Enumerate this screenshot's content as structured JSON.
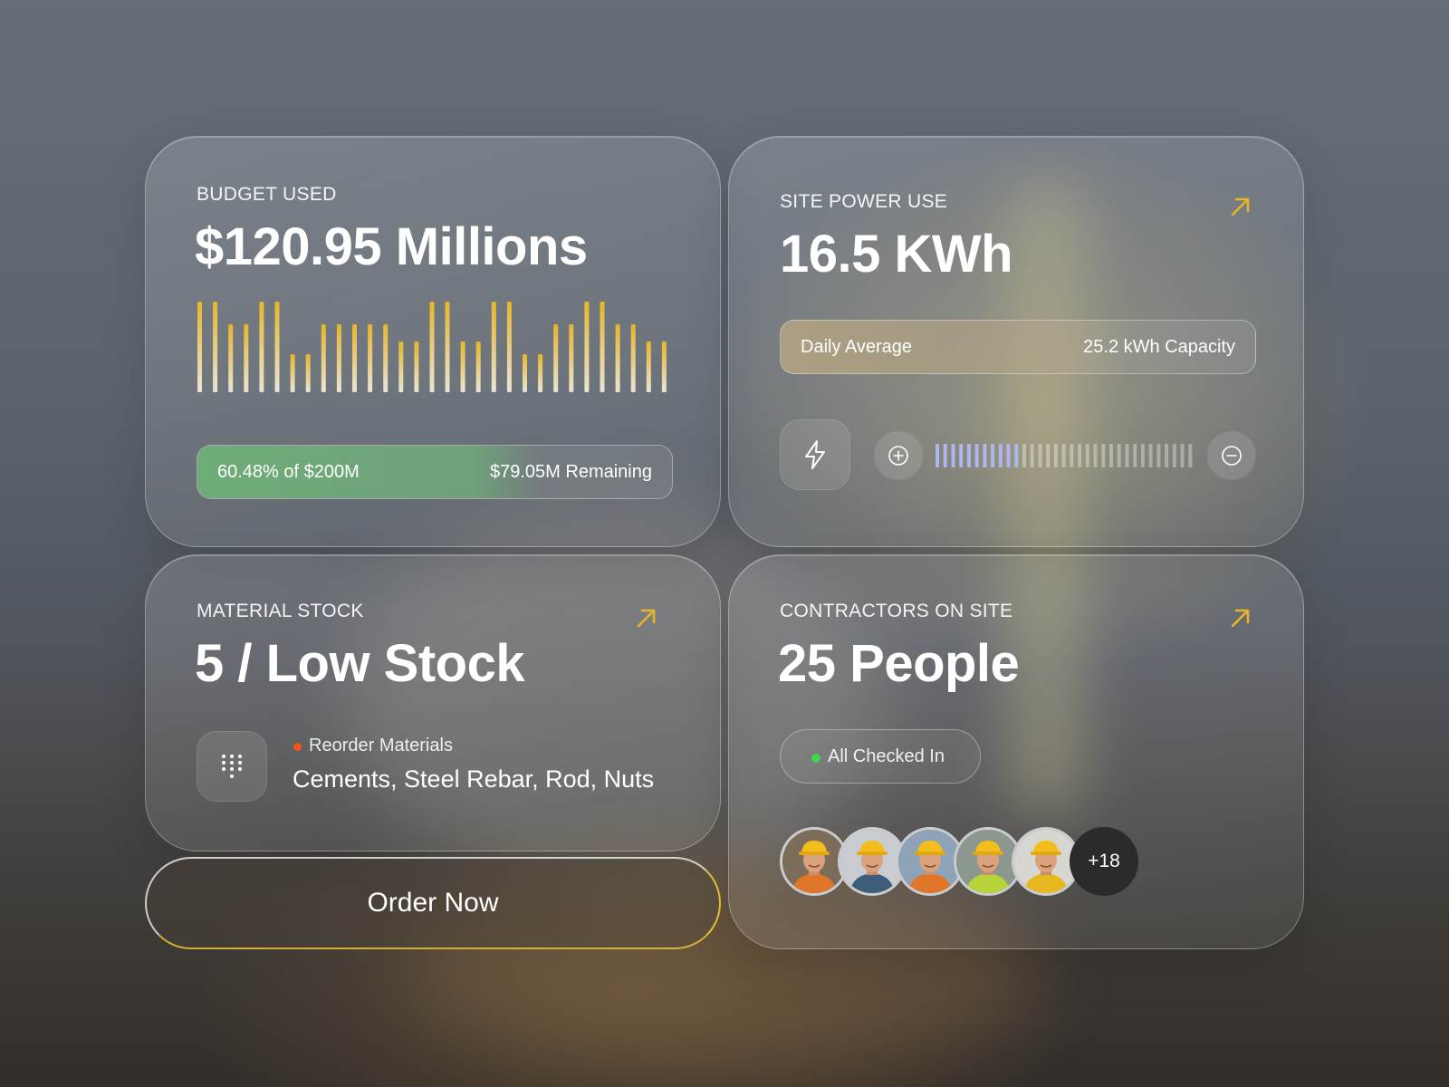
{
  "colors": {
    "accent_yellow": "#e8b52a",
    "progress_green": "#6eaf78",
    "status_green": "#3fd64a",
    "alert_red": "#f2561d",
    "power_active_tick": "#aeb6f0"
  },
  "budget": {
    "label": "BUDGET USED",
    "value": "$120.95 Millions",
    "bar_levels": [
      1,
      1,
      0.75,
      0.75,
      1,
      1,
      0.42,
      0.42,
      0.75,
      0.75,
      0.75,
      0.75,
      0.75,
      0.56,
      0.56,
      1,
      1,
      0.56,
      0.56,
      1,
      1,
      0.42,
      0.42,
      0.75,
      0.75,
      1,
      1,
      0.75,
      0.75,
      0.56,
      0.56
    ],
    "progress_percent": 60.48,
    "progress_label": "60.48% of $200M",
    "remaining_label": "$79.05M Remaining"
  },
  "power": {
    "label": "SITE POWER USE",
    "value": "16.5 KWh",
    "arrow_icon": "arrow-up-right-icon",
    "average_label": "Daily Average",
    "capacity_label": "25.2 kWh Capacity",
    "lightning_icon": "lightning-icon",
    "plus_icon": "plus-circle-icon",
    "minus_icon": "minus-circle-icon",
    "level_ticks_total": 33,
    "level_ticks_active": 11
  },
  "stock": {
    "label": "MATERIAL STOCK",
    "value": "5 / Low Stock",
    "arrow_icon": "arrow-up-right-icon",
    "grid_icon": "dial-pad-icon",
    "alert_title": "Reorder Materials",
    "materials": "Cements, Steel Rebar, Rod, Nuts"
  },
  "order_button": {
    "label": "Order Now"
  },
  "contractors": {
    "label": "CONTRACTORS ON SITE",
    "value": "25 People",
    "arrow_icon": "arrow-up-right-icon",
    "status_label": "All Checked In",
    "avatars": [
      {
        "icon": "worker-avatar-icon",
        "vest": "#e0762a",
        "bg": "#7c6d5a"
      },
      {
        "icon": "worker-avatar-icon",
        "vest": "#3d5d7a",
        "bg": "#c9ccd0"
      },
      {
        "icon": "worker-avatar-icon",
        "vest": "#e0762a",
        "bg": "#8ea3b8"
      },
      {
        "icon": "worker-avatar-icon",
        "vest": "#b6d43a",
        "bg": "#8c9790"
      },
      {
        "icon": "worker-avatar-icon",
        "vest": "#e6b820",
        "bg": "#d8d6d0"
      }
    ],
    "more_count": "+18"
  }
}
